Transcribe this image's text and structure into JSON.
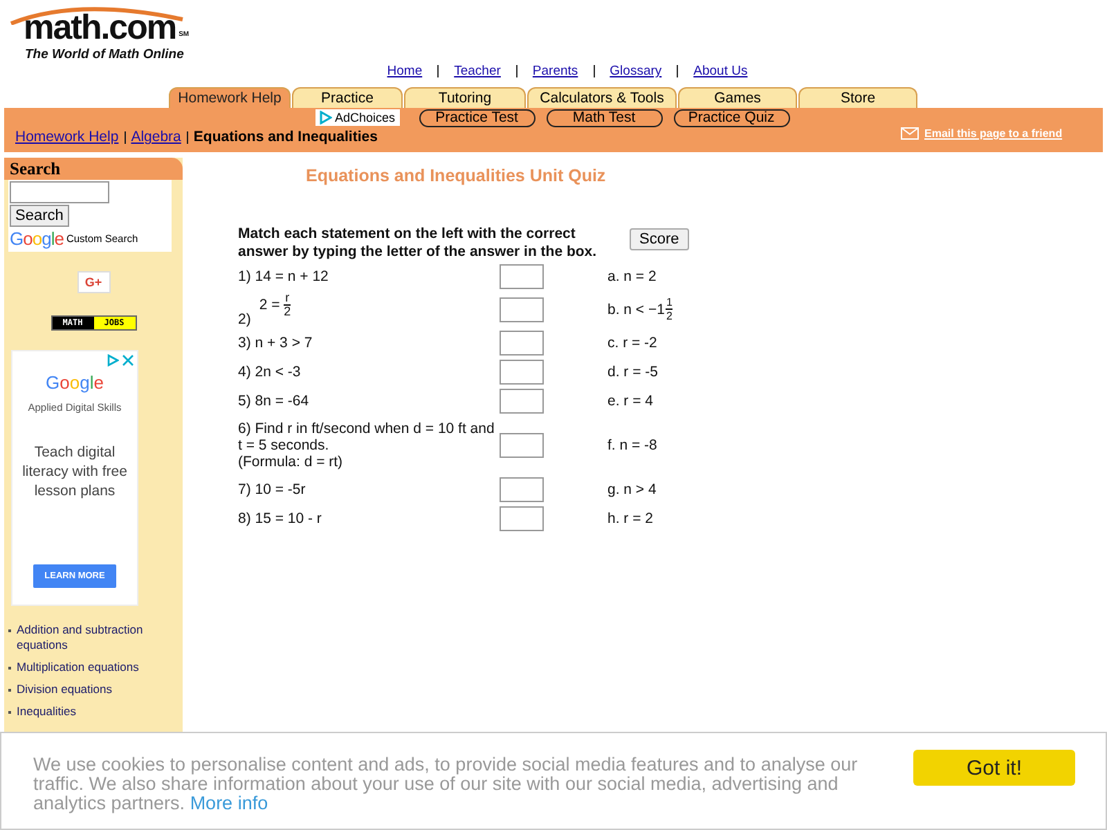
{
  "header": {
    "logo": "math.com",
    "logo_mark": "SM",
    "tagline": "The World of Math Online"
  },
  "top_links": [
    "Home",
    "Teacher",
    "Parents",
    "Glossary",
    "About Us"
  ],
  "tabs": [
    {
      "label": "Homework Help",
      "selected": true
    },
    {
      "label": "Practice",
      "selected": false
    },
    {
      "label": "Tutoring",
      "selected": false
    },
    {
      "label": "Calculators & Tools",
      "selected": false
    },
    {
      "label": "Games",
      "selected": false
    },
    {
      "label": "Store",
      "selected": false
    }
  ],
  "subnav": {
    "ad_choices": "AdChoices",
    "buttons": [
      "Practice Test",
      "Math Test",
      "Practice Quiz"
    ]
  },
  "breadcrumb": [
    {
      "label": "Homework Help",
      "kind": "link"
    },
    {
      "label": "Algebra",
      "kind": "link"
    },
    {
      "label": "Equations and Inequalities",
      "kind": "current"
    }
  ],
  "email_link": "Email this page to a friend",
  "sidebar": {
    "search_title": "Search",
    "search_button": "Search",
    "google": "Google",
    "custom_search": "Custom Search",
    "gplus": "G+",
    "jobs": [
      "MATH",
      "JOBS"
    ],
    "ad": {
      "brand": "Google",
      "subtitle": "Applied Digital Skills",
      "text": "Teach digital literacy with free lesson plans",
      "button": "LEARN MORE"
    },
    "links": [
      "Addition and subtraction equations",
      "Multiplication equations",
      "Division equations",
      "Inequalities"
    ]
  },
  "quiz": {
    "title": "Equations and Inequalities Unit Quiz",
    "instructions": "Match each statement on the left with the correct answer by typing the letter of the answer in the box.",
    "score_button": "Score",
    "questions": [
      {
        "kind": "text",
        "text": "1) 14 = n + 12"
      },
      {
        "kind": "fraction",
        "number": "2)",
        "lhs": "2 =",
        "num": "r",
        "den": "2"
      },
      {
        "kind": "text",
        "text": "3) n + 3 > 7"
      },
      {
        "kind": "text",
        "text": "4) 2n < -3"
      },
      {
        "kind": "text",
        "text": "5) 8n = -64"
      },
      {
        "kind": "text",
        "text": "6) Find r in ft/second when d = 10 ft and t = 5 seconds.\n(Formula: d = rt)"
      },
      {
        "kind": "text",
        "text": "7) 10 = -5r"
      },
      {
        "kind": "text",
        "text": "8) 15 = 10 - r"
      }
    ],
    "answers": [
      {
        "kind": "text",
        "text": "a. n = 2"
      },
      {
        "kind": "mixed",
        "text": "b. n < −1",
        "num": "1",
        "den": "2"
      },
      {
        "kind": "text",
        "text": "c. r = -2"
      },
      {
        "kind": "text",
        "text": "d. r = -5"
      },
      {
        "kind": "text",
        "text": "e. r = 4"
      },
      {
        "kind": "text",
        "text": "f. n = -8"
      },
      {
        "kind": "text",
        "text": "g. n > 4"
      },
      {
        "kind": "text",
        "text": "h. r = 2"
      }
    ]
  },
  "cookie_bar": {
    "text": "We use cookies to personalise content and ads, to provide social media features and to analyse our traffic. We also share information about your use of our site with our social media, advertising and analytics partners.",
    "link": "More info",
    "button": "Got it!"
  }
}
